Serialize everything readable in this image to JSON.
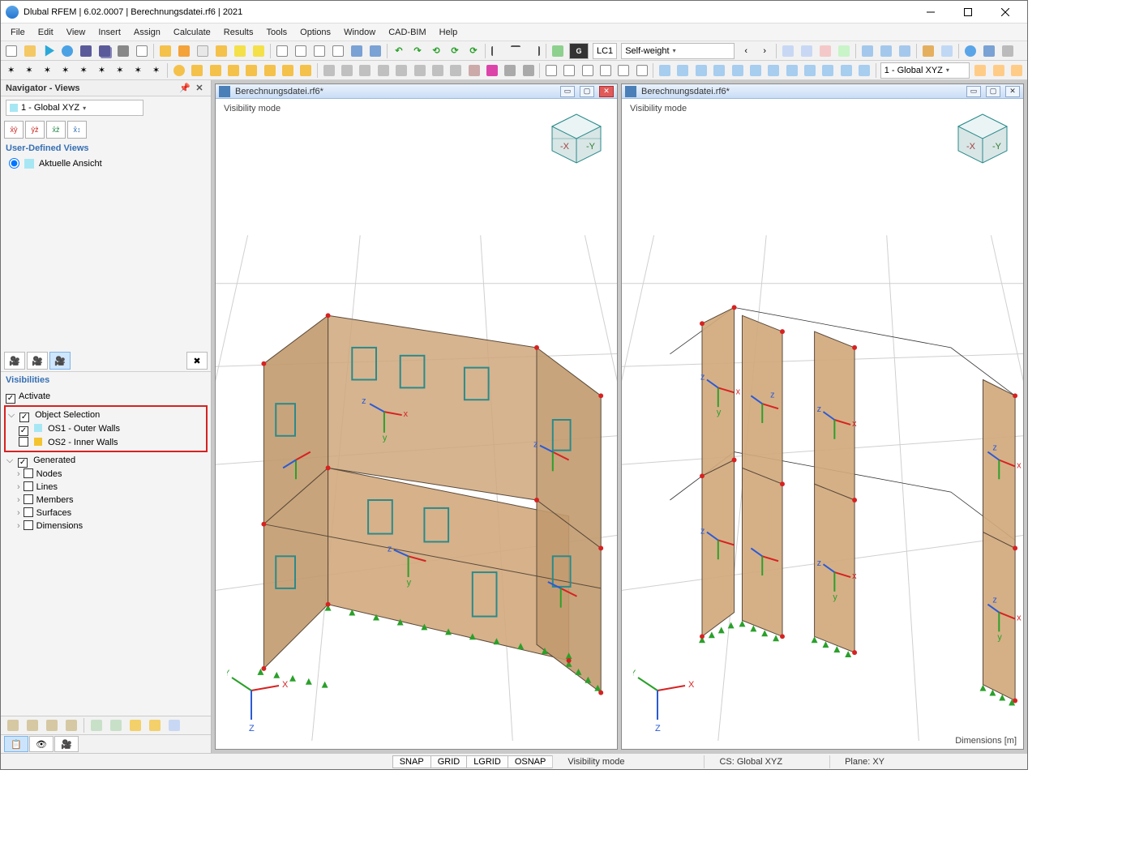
{
  "title": "Dlubal RFEM | 6.02.0007 | Berechnungsdatei.rf6 | 2021",
  "menu": [
    "File",
    "Edit",
    "View",
    "Insert",
    "Assign",
    "Calculate",
    "Results",
    "Tools",
    "Options",
    "Window",
    "CAD-BIM",
    "Help"
  ],
  "toolbar1": {
    "lc_code": "LC1",
    "lc_name": "Self-weight",
    "glyph_G": "G"
  },
  "toolbar2": {
    "cs_combo": "1 - Global XYZ"
  },
  "navigator": {
    "title": "Navigator - Views",
    "cs_combo": "1 - Global XYZ",
    "userviews_label": "User-Defined Views",
    "current_view": "Aktuelle Ansicht",
    "visibilities_label": "Visibilities",
    "activate": "Activate",
    "tree": {
      "object_selection": "Object Selection",
      "os1": "OS1 - Outer Walls",
      "os2": "OS2 - Inner Walls",
      "generated": "Generated",
      "nodes": "Nodes",
      "lines": "Lines",
      "members": "Members",
      "surfaces": "Surfaces",
      "dimensions": "Dimensions"
    }
  },
  "viewport": {
    "doc_title": "Berechnungsdatei.rf6*",
    "mode": "Visibility mode",
    "dims": "Dimensions [m]"
  },
  "status": {
    "snap": "SNAP",
    "grid": "GRID",
    "lgrid": "LGRID",
    "osnap": "OSNAP",
    "vmode": "Visibility mode",
    "cs": "CS: Global XYZ",
    "plane": "Plane: XY"
  }
}
